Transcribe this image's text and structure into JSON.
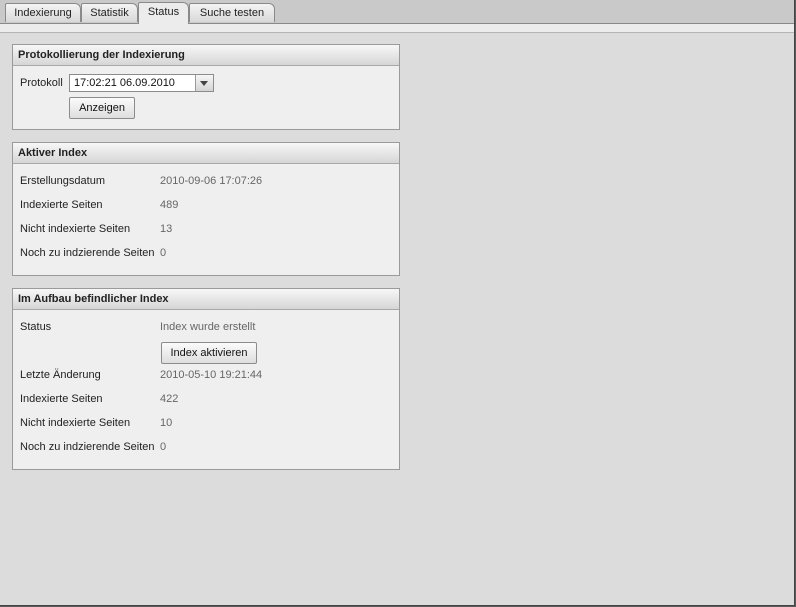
{
  "tabs": [
    {
      "label": "Indexierung"
    },
    {
      "label": "Statistik"
    },
    {
      "label": "Status"
    },
    {
      "label": "Suche testen"
    }
  ],
  "active_tab": "Status",
  "protokoll_panel": {
    "title": "Protokollierung der Indexierung",
    "label": "Protokoll",
    "selected": "17:02:21 06.09.2010",
    "button": "Anzeigen"
  },
  "aktiver_index": {
    "title": "Aktiver Index",
    "rows": [
      {
        "label": "Erstellungsdatum",
        "value": "2010-09-06 17:07:26"
      },
      {
        "label": "Indexierte Seiten",
        "value": "489"
      },
      {
        "label": "Nicht indexierte Seiten",
        "value": "13"
      },
      {
        "label": "Noch zu indzierende Seiten",
        "value": "0"
      }
    ]
  },
  "aufbau_index": {
    "title": "Im Aufbau befindlicher Index",
    "status_label": "Status",
    "status_value": "Index wurde erstellt",
    "button": "Index aktivieren",
    "rows": [
      {
        "label": "Letzte Änderung",
        "value": "2010-05-10 19:21:44"
      },
      {
        "label": "Indexierte Seiten",
        "value": "422"
      },
      {
        "label": "Nicht indexierte Seiten",
        "value": "10"
      },
      {
        "label": "Noch zu indzierende Seiten",
        "value": "0"
      }
    ]
  }
}
